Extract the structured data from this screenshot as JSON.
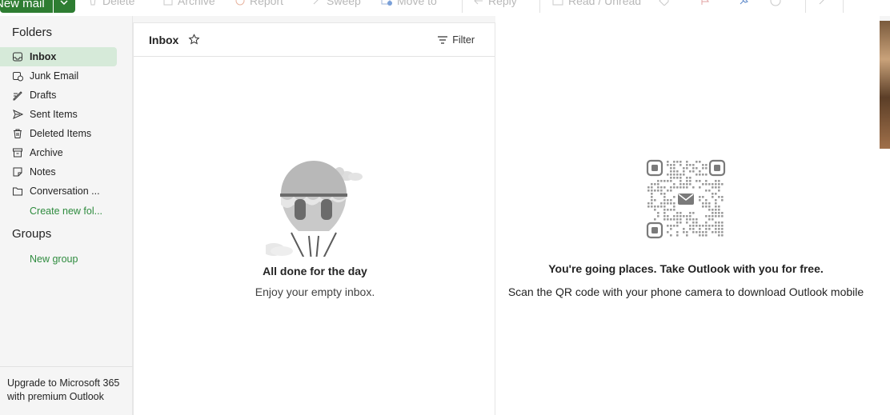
{
  "toolbar": {
    "new_mail": "New mail",
    "items": [
      "Delete",
      "Archive",
      "Report",
      "Sweep",
      "Move to",
      "Reply",
      "Read / Unread"
    ],
    "more": "···"
  },
  "sidebar": {
    "folders_title": "Folders",
    "folders": [
      {
        "label": "Inbox",
        "icon": "inbox-icon"
      },
      {
        "label": "Junk Email",
        "icon": "junk-icon"
      },
      {
        "label": "Drafts",
        "icon": "drafts-icon"
      },
      {
        "label": "Sent Items",
        "icon": "sent-icon"
      },
      {
        "label": "Deleted Items",
        "icon": "trash-icon"
      },
      {
        "label": "Archive",
        "icon": "archive-icon"
      },
      {
        "label": "Notes",
        "icon": "notes-icon"
      },
      {
        "label": "Conversation ...",
        "icon": "folder-icon"
      }
    ],
    "create_folder": "Create new fol...",
    "groups_title": "Groups",
    "new_group": "New group",
    "upgrade": "Upgrade to Microsoft 365 with premium Outlook"
  },
  "list": {
    "title": "Inbox",
    "filter": "Filter",
    "empty_title": "All done for the day",
    "empty_sub": "Enjoy your empty inbox."
  },
  "pane": {
    "title": "You're going places. Take Outlook with you for free.",
    "sub": "Scan the QR code with your phone camera to download Outlook mobile"
  },
  "colors": {
    "accent": "#2e7d32",
    "link": "#2e8b3e",
    "selected": "#d6ead9"
  }
}
